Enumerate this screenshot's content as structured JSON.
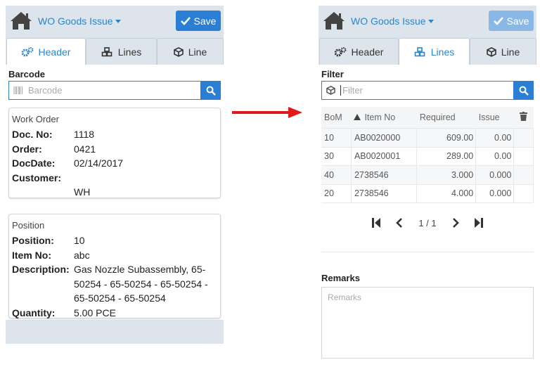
{
  "left": {
    "app_title": "WO Goods Issue",
    "save_label": "Save",
    "tabs": [
      {
        "label": "Header"
      },
      {
        "label": "Lines"
      },
      {
        "label": "Line"
      }
    ],
    "barcode": {
      "label": "Barcode",
      "placeholder": "Barcode"
    },
    "work_order": {
      "title": "Work Order",
      "fields": [
        {
          "key": "Doc. No:",
          "value": "1118"
        },
        {
          "key": "Order:",
          "value": "0421"
        },
        {
          "key": "DocDate:",
          "value": "02/14/2017"
        },
        {
          "key": "Customer:",
          "value": ""
        },
        {
          "key": "",
          "value": "WH"
        }
      ]
    },
    "position": {
      "title": "Position",
      "fields": [
        {
          "key": "Position:",
          "value": "10"
        },
        {
          "key": "Item No:",
          "value": "abc"
        },
        {
          "key": "Description:",
          "value": "Gas Nozzle Subassembly, 65-50254 - 65-50254 - 65-50254 - 65-50254 - 65-50254"
        },
        {
          "key": "Quantity:",
          "value": "5.00 PCE"
        }
      ]
    }
  },
  "right": {
    "app_title": "WO Goods Issue",
    "save_label": "Save",
    "tabs": [
      {
        "label": "Header"
      },
      {
        "label": "Lines"
      },
      {
        "label": "Line"
      }
    ],
    "filter": {
      "label": "Filter",
      "placeholder": "Filter"
    },
    "table": {
      "headers": [
        "BoM",
        "Item No",
        "Required",
        "Issue"
      ],
      "rows": [
        [
          "10",
          "AB0020000",
          "609.00",
          "0.00"
        ],
        [
          "30",
          "AB0020001",
          "289.00",
          "0.00"
        ],
        [
          "40",
          "2738546",
          "3.000",
          "0.000"
        ],
        [
          "20",
          "2738546",
          "4.000",
          "0.000"
        ]
      ]
    },
    "pager": {
      "text": "1 / 1"
    },
    "remarks": {
      "label": "Remarks",
      "placeholder": "Remarks"
    }
  },
  "colors": {
    "accent": "#2a86c9",
    "button": "#2a7fd4",
    "button_disabled": "#8ab8e6",
    "toolbar_bg": "#dde4ec",
    "arrow": "#e0191b"
  },
  "icons": [
    "home-icon",
    "chevron-down-icon",
    "check-icon",
    "cogs-icon",
    "cubes-icon",
    "cube-icon",
    "barcode-icon",
    "search-icon",
    "sort-asc-icon",
    "trash-icon",
    "first-page-icon",
    "prev-page-icon",
    "next-page-icon",
    "last-page-icon",
    "right-arrow-icon"
  ]
}
